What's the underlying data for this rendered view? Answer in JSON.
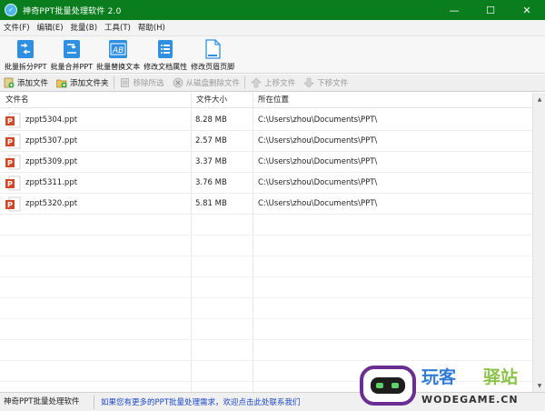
{
  "window": {
    "title": "神奇PPT批量处理软件 2.0",
    "controls": {
      "minimize": "—",
      "maximize": "☐",
      "close": "✕"
    }
  },
  "menu": [
    {
      "label": "文件(F)"
    },
    {
      "label": "编辑(E)"
    },
    {
      "label": "批量(B)"
    },
    {
      "label": "工具(T)"
    },
    {
      "label": "帮助(H)"
    }
  ],
  "toolbar": [
    {
      "label": "批量拆分PPT",
      "icon": "split-icon",
      "color": "#2f8fe0"
    },
    {
      "label": "批量合并PPT",
      "icon": "merge-icon",
      "color": "#2f8fe0"
    },
    {
      "label": "批量替换文本",
      "icon": "replace-text-icon",
      "color": "#2f8fe0"
    },
    {
      "label": "修改文档属性",
      "icon": "properties-icon",
      "color": "#2f8fe0"
    },
    {
      "label": "修改页眉页脚",
      "icon": "header-footer-icon",
      "color": "#2f8fe0"
    }
  ],
  "actions": [
    {
      "label": "添加文件",
      "enabled": true
    },
    {
      "label": "添加文件夹",
      "enabled": true
    },
    {
      "label": "移除所选",
      "enabled": false
    },
    {
      "label": "从磁盘删除文件",
      "enabled": false
    },
    {
      "label": "上移文件",
      "enabled": false
    },
    {
      "label": "下移文件",
      "enabled": false
    }
  ],
  "columns": {
    "name": "文件名",
    "size": "文件大小",
    "location": "所在位置"
  },
  "files": [
    {
      "name": "zppt5304.ppt",
      "size": "8.28 MB",
      "location": "C:\\Users\\zhou\\Documents\\PPT\\"
    },
    {
      "name": "zppt5307.ppt",
      "size": "2.57 MB",
      "location": "C:\\Users\\zhou\\Documents\\PPT\\"
    },
    {
      "name": "zppt5309.ppt",
      "size": "3.37 MB",
      "location": "C:\\Users\\zhou\\Documents\\PPT\\"
    },
    {
      "name": "zppt5311.ppt",
      "size": "3.76 MB",
      "location": "C:\\Users\\zhou\\Documents\\PPT\\"
    },
    {
      "name": "zppt5320.ppt",
      "size": "5.81 MB",
      "location": "C:\\Users\\zhou\\Documents\\PPT\\"
    }
  ],
  "status": {
    "app": "神奇PPT批量处理软件 2.0",
    "link": "如果您有更多的PPT批量处理需求，欢迎点击此处联系我们"
  },
  "watermark": {
    "text1": "玩客",
    "text2": "驿站",
    "domain": "WODEGAME.CN"
  },
  "colors": {
    "titlebar": "#0a7d1f",
    "accent": "#2f8fe0",
    "ppt_icon": "#d24726",
    "link": "#1a47c8"
  }
}
